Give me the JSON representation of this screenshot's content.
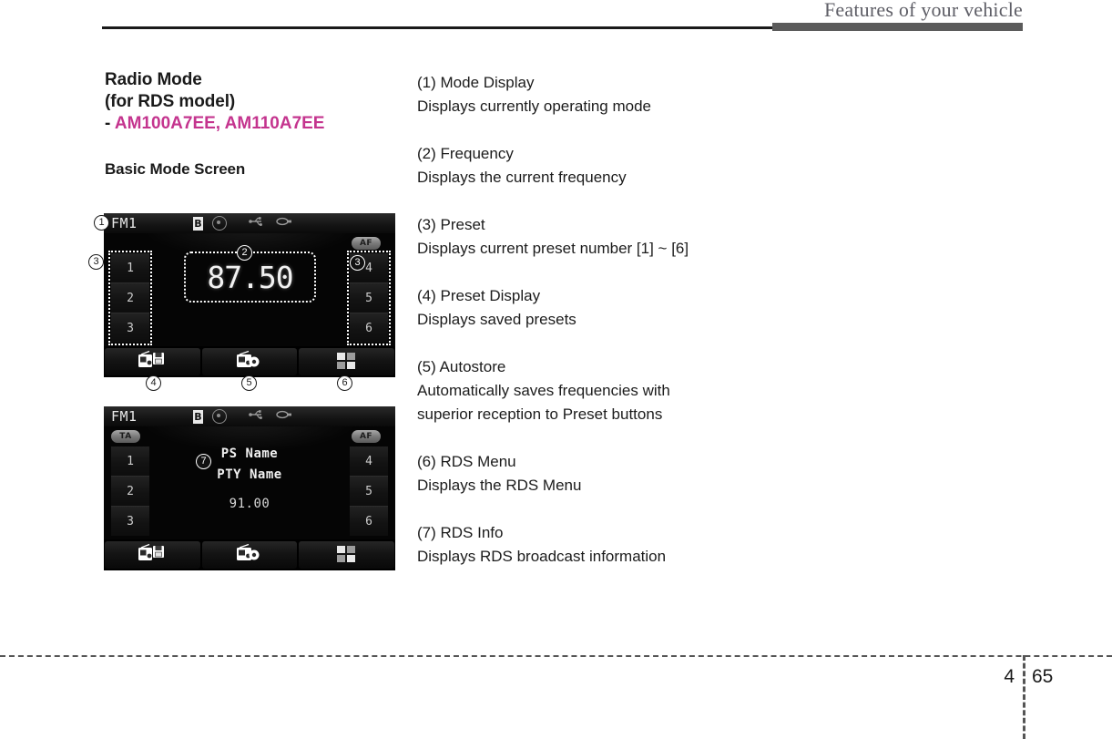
{
  "header": {
    "title": "Features of your vehicle"
  },
  "left_column": {
    "heading_line1": "Radio Mode",
    "heading_line2": "(for RDS model)",
    "heading_dash": "-",
    "model_codes": "AM100A7EE,  AM110A7EE",
    "subheading": "Basic Mode Screen"
  },
  "descriptions": [
    {
      "title": "(1) Mode Display",
      "body": "Displays currently operating mode"
    },
    {
      "title": "(2) Frequency",
      "body": "Displays the current frequency"
    },
    {
      "title": "(3) Preset",
      "body": "Displays current preset number [1] ~ [6]"
    },
    {
      "title": "(4) Preset Display",
      "body": "Displays saved presets"
    },
    {
      "title": "(5) Autostore",
      "body": "Automatically saves frequencies with superior reception to Preset buttons"
    },
    {
      "title": "(6) RDS Menu",
      "body": "Displays the RDS Menu"
    },
    {
      "title": "(7) RDS Info",
      "body": "Displays RDS broadcast information"
    }
  ],
  "basic_screen": {
    "mode_label": "FM1",
    "status_icons": [
      "bluetooth-icon",
      "disc-icon",
      "usb-icon",
      "aux-icon"
    ],
    "af_label": "AF",
    "presets_left": [
      "1",
      "2",
      "3"
    ],
    "presets_right": [
      "4",
      "5",
      "6"
    ],
    "frequency": "87.50",
    "bottom_buttons": [
      "preset-display-icon",
      "autostore-icon",
      "rds-menu-icon"
    ],
    "callouts": {
      "mode": "1",
      "frequency": "2",
      "preset_left": "3",
      "preset_right": "3",
      "preset_display": "4",
      "autostore": "5",
      "rds_menu": "6"
    }
  },
  "rds_screen": {
    "mode_label": "FM1",
    "ta_label": "TA",
    "af_label": "AF",
    "presets_left": [
      "1",
      "2",
      "3"
    ],
    "presets_right": [
      "4",
      "5",
      "6"
    ],
    "ps_name": "PS Name",
    "pty_name": "PTY Name",
    "frequency": "91.00",
    "bottom_buttons": [
      "preset-display-icon",
      "autostore-icon",
      "rds-menu-icon"
    ],
    "callouts": {
      "rds_info": "7"
    }
  },
  "footer": {
    "chapter": "4",
    "page": "65"
  },
  "colors": {
    "accent_magenta": "#c4348e",
    "header_gray": "#5b5b5b",
    "text_black": "#1a1a1a"
  }
}
